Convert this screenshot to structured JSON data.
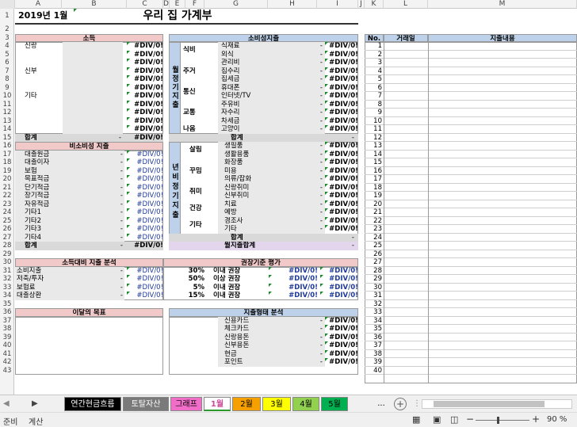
{
  "columns": [
    "A",
    "B",
    "C",
    "D",
    "E",
    "F",
    "G",
    "H",
    "I",
    "J",
    "K",
    "L",
    "M"
  ],
  "rows": [
    "1",
    "2",
    "3",
    "4",
    "5",
    "6",
    "7",
    "8",
    "9",
    "10",
    "11",
    "12",
    "13",
    "14",
    "15",
    "16",
    "17",
    "18",
    "19",
    "20",
    "21",
    "22",
    "23",
    "24",
    "25",
    "26",
    "27",
    "28",
    "29",
    "30",
    "31",
    "32",
    "33",
    "34",
    "35",
    "36",
    "37",
    "38",
    "39",
    "40",
    "41",
    "42",
    "43"
  ],
  "title": {
    "date": "2019년 1월",
    "main": "우리 집 가계부"
  },
  "income": {
    "header": "소득",
    "labels": [
      "신랑",
      "",
      "",
      "신부",
      "",
      "",
      "기타"
    ],
    "total_label": "합계",
    "div": "#DIV/0!",
    "dash": "-"
  },
  "nonconsume": {
    "header": "비소비성 지출",
    "items": [
      "대출원금",
      "대출이자",
      "보험",
      "목표적금",
      "단기적금",
      "장기적금",
      "자유적금",
      "기타1",
      "기타2",
      "기타3",
      "기타4"
    ],
    "total_label": "합계"
  },
  "consume": {
    "header": "소비성지출",
    "regular_label": "월정기지출",
    "irregular_label": "년비정기지출",
    "regular": [
      {
        "cat": "식비",
        "items": [
          "식재료",
          "외식"
        ]
      },
      {
        "cat": "주거",
        "items": [
          "관리비",
          "집수리",
          "집세금"
        ]
      },
      {
        "cat": "통신",
        "items": [
          "휴대폰",
          "인터넷/TV"
        ]
      },
      {
        "cat": "교통",
        "items": [
          "주유비",
          "자수리",
          "차세금"
        ]
      },
      {
        "cat": "나옴",
        "items": [
          "고양이"
        ]
      }
    ],
    "regular_total": "합계",
    "irregular": [
      {
        "cat": "살림",
        "items": [
          "생필품",
          "생활용품"
        ]
      },
      {
        "cat": "꾸밈",
        "items": [
          "화장품",
          "미용",
          "의류/잡화"
        ]
      },
      {
        "cat": "취미",
        "items": [
          "신랑취미",
          "신부취미"
        ]
      },
      {
        "cat": "건강",
        "items": [
          "치료",
          "예방"
        ]
      },
      {
        "cat": "기타",
        "items": [
          "경조사",
          "기타"
        ]
      }
    ],
    "irregular_total": "합계",
    "month_total": "월지출합계"
  },
  "analysis": {
    "header": "소득대비 지출 분석",
    "items": [
      "소비지출",
      "저축/투자",
      "보험료",
      "대출상환"
    ]
  },
  "standard": {
    "header": "권장기준 평가",
    "rows": [
      {
        "pct": "30%",
        "txt": "이내 권장"
      },
      {
        "pct": "50%",
        "txt": "이상 권장"
      },
      {
        "pct": "5%",
        "txt": "이내 권장"
      },
      {
        "pct": "15%",
        "txt": "이내 권장"
      }
    ]
  },
  "goal": {
    "header": "이달의 목표"
  },
  "payment": {
    "header": "지출형태 분석",
    "items": [
      "신용카드",
      "체크카드",
      "신랑용돈",
      "신부용돈",
      "현금",
      "포인트"
    ]
  },
  "ledger": {
    "no": "No.",
    "date": "거래일",
    "content": "지출내용",
    "count": 26
  },
  "tabs": [
    {
      "label": "연간현금흐름",
      "bg": "#000000",
      "fg": "#ffffff"
    },
    {
      "label": "토탈자산",
      "bg": "#7a7a7a",
      "fg": "#ffffff"
    },
    {
      "label": "그래프",
      "bg": "#f06ec8",
      "fg": "#000000"
    },
    {
      "label": "1월",
      "bg": "#ffffff",
      "fg": "#d04a9a"
    },
    {
      "label": "2월",
      "bg": "#f5a000",
      "fg": "#000000"
    },
    {
      "label": "3월",
      "bg": "#ffff00",
      "fg": "#000000"
    },
    {
      "label": "4월",
      "bg": "#92d050",
      "fg": "#000000"
    },
    {
      "label": "5월",
      "bg": "#00b050",
      "fg": "#000000"
    }
  ],
  "tab_more": "...",
  "status": {
    "ready": "준비",
    "calc": "계산",
    "zoom": "90 %"
  }
}
